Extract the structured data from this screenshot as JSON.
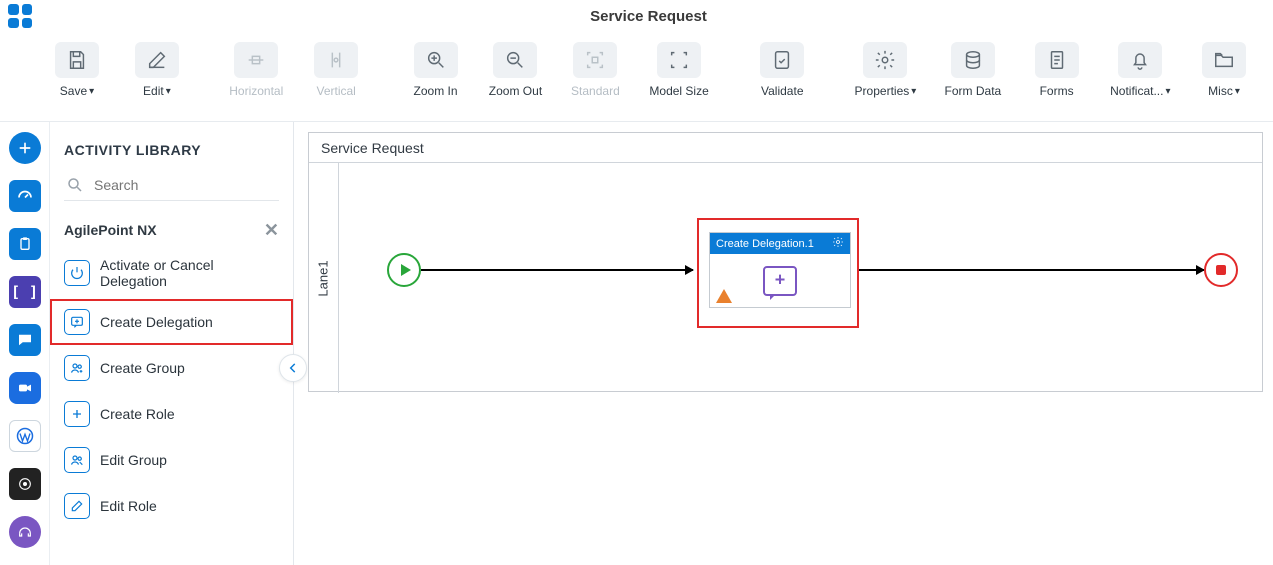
{
  "header": {
    "title": "Service Request"
  },
  "toolbar": {
    "save": {
      "label": "Save",
      "caret": true
    },
    "edit": {
      "label": "Edit",
      "caret": true
    },
    "horizontal": {
      "label": "Horizontal",
      "disabled": true
    },
    "vertical": {
      "label": "Vertical",
      "disabled": true
    },
    "zoom_in": {
      "label": "Zoom In"
    },
    "zoom_out": {
      "label": "Zoom Out"
    },
    "standard": {
      "label": "Standard",
      "disabled": true
    },
    "model_size": {
      "label": "Model Size"
    },
    "validate": {
      "label": "Validate"
    },
    "properties": {
      "label": "Properties",
      "caret": true
    },
    "form_data": {
      "label": "Form Data"
    },
    "forms": {
      "label": "Forms"
    },
    "notif": {
      "label": "Notificat...",
      "caret": true
    },
    "misc": {
      "label": "Misc",
      "caret": true
    }
  },
  "library": {
    "header": "ACTIVITY LIBRARY",
    "search_placeholder": "Search",
    "category": "AgilePoint NX",
    "items": [
      {
        "label": "Activate or Cancel Delegation"
      },
      {
        "label": "Create Delegation"
      },
      {
        "label": "Create Group"
      },
      {
        "label": "Create Role"
      },
      {
        "label": "Edit Group"
      },
      {
        "label": "Edit Role"
      }
    ]
  },
  "canvas": {
    "title": "Service Request",
    "lane": "Lane1",
    "activity": {
      "title": "Create Delegation.1"
    }
  }
}
